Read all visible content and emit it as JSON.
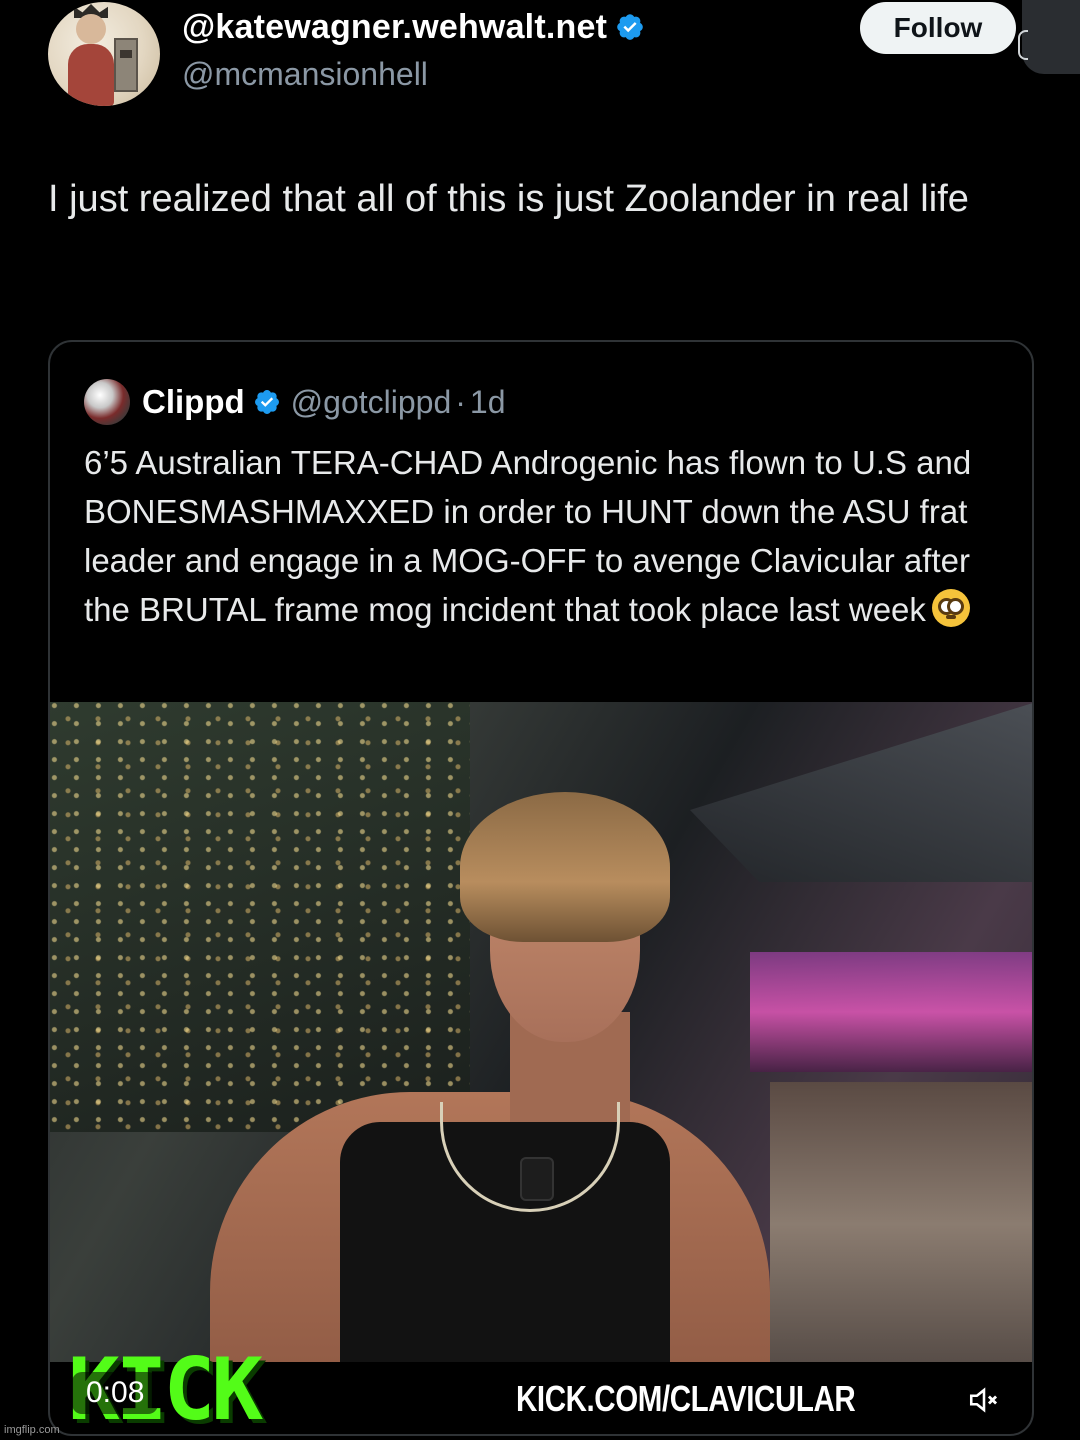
{
  "tweet": {
    "display_name": "@katewagner.wehwalt.net",
    "handle": "@mcmansionhell",
    "follow_label": "Follow",
    "text": "I just realized that all of this is just Zoolander in real life"
  },
  "quote": {
    "name": "Clippd",
    "handle": "@gotclippd",
    "separator": "·",
    "time": "1d",
    "text": "6’5 Australian TERA-CHAD Androgenic has flown to U.S and BONESMASHMAXXED in order to HUNT down the ASU frat leader and engage in a MOG-OFF to avenge Clavicular after the BRUTAL frame mog incident that took place last week",
    "emoji": "flushed-face-emoji",
    "video": {
      "timestamp": "0:08",
      "brand_logo": "KICK",
      "overlay_url": "KICK.COM/CLAVICULAR",
      "mute_icon": "speaker-muted-icon"
    }
  },
  "colors": {
    "background": "#000000",
    "verified_badge": "#1d9bf0",
    "kick_green": "#53fc18",
    "secondary_text": "#8b98a5"
  },
  "watermark": "imgflip.com"
}
